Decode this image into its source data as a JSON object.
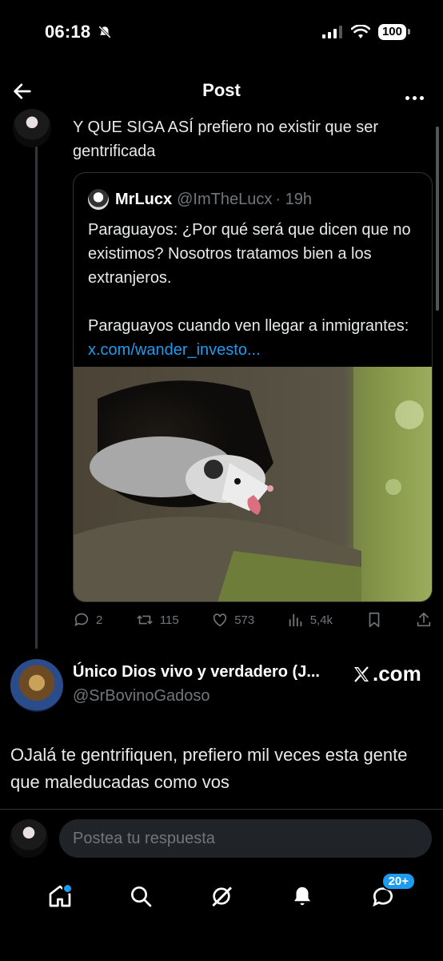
{
  "status_bar": {
    "time": "06:18",
    "battery": "100"
  },
  "header": {
    "title": "Post"
  },
  "post": {
    "text": "Y QUE SIGA ASÍ prefiero no existir que ser gentrificada"
  },
  "quote": {
    "name": "MrLucx",
    "handle": "@ImTheLucx",
    "time": "· 19h",
    "line1": "Paraguayos: ¿Por qué será que dicen que no existimos? Nosotros tratamos bien a los extranjeros.",
    "line2": "Paraguayos cuando ven llegar a inmigrantes: ",
    "link": "x.com/wander_investo..."
  },
  "actions": {
    "replies": "2",
    "reposts": "115",
    "likes": "573",
    "views": "5,4k"
  },
  "reply": {
    "name": "Único Dios vivo y verdadero (J...",
    "handle": "@SrBovinoGadoso",
    "source": ".com",
    "text": "OJalá te gentrifiquen, prefiero mil veces esta gente que maleducadas como vos"
  },
  "composer": {
    "placeholder": "Postea tu respuesta"
  },
  "tabbar": {
    "messages_badge": "20+"
  },
  "colors": {
    "accent": "#1d9bf0",
    "muted": "#71767b",
    "background": "#000000"
  }
}
